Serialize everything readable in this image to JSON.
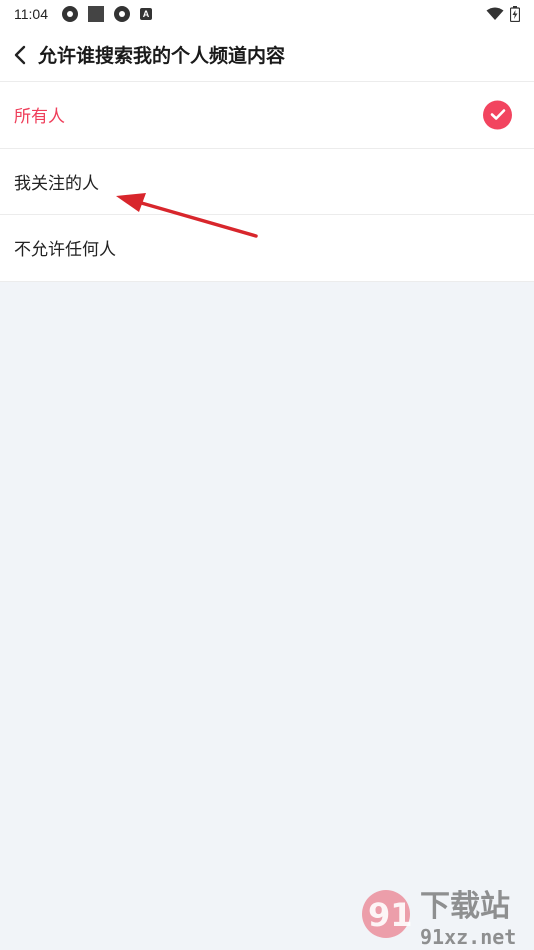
{
  "status_bar": {
    "time": "11:04",
    "badge_letter": "A"
  },
  "header": {
    "title": "允许谁搜索我的个人频道内容",
    "back_icon": "chevron-left-icon"
  },
  "options": [
    {
      "label": "所有人",
      "selected": true
    },
    {
      "label": "我关注的人",
      "selected": false
    },
    {
      "label": "不允许任何人",
      "selected": false
    }
  ],
  "colors": {
    "accent": "#ef3e5a",
    "background": "#f1f4f8",
    "annotation_arrow": "#d8262c"
  },
  "watermark": {
    "brand": "下载站",
    "domain": "91xz.net",
    "logo_text": "91"
  }
}
